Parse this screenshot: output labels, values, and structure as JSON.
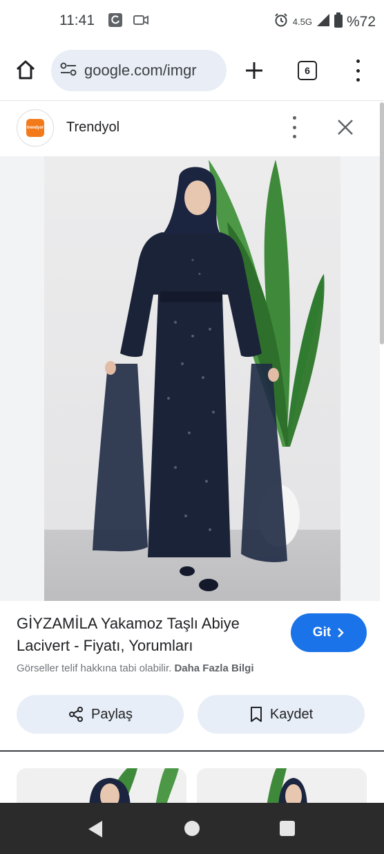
{
  "status_bar": {
    "time": "11:41",
    "network": "4.5G",
    "battery": "%72",
    "icons": [
      "sync-app-icon",
      "video-camera-icon",
      "alarm-icon",
      "signal-icon",
      "battery-icon"
    ]
  },
  "browser": {
    "url": "google.com/imgr",
    "tab_count": "6",
    "icons": [
      "home-icon",
      "site-settings-icon",
      "plus-icon",
      "more-vertical-icon"
    ]
  },
  "source": {
    "name": "Trendyol",
    "logo_text": "trendyol",
    "brand_color": "#f27a1a"
  },
  "product": {
    "title": "GİYZAMİLA Yakamoz Taşlı Abiye Lacivert - Fiyatı, Yorumları",
    "visit_label": "Git",
    "copyright_text": "Görseller telif hakkına tabi olabilir.",
    "more_info_label": "Daha Fazla Bilgi"
  },
  "actions": {
    "share_label": "Paylaş",
    "save_label": "Kaydet"
  },
  "colors": {
    "accent": "#1a73e8",
    "dress": "#1b2338",
    "chip_bg": "#e8eef7"
  }
}
